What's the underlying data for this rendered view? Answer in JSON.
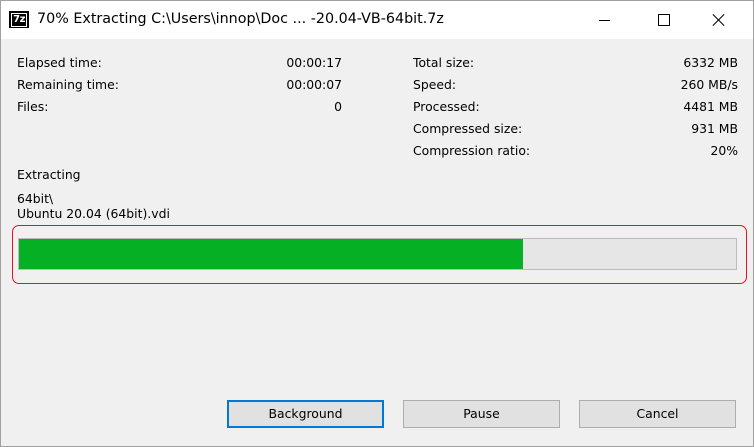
{
  "window": {
    "title": "70% Extracting C:\\Users\\innop\\Doc ... -20.04-VB-64bit.7z",
    "app_icon_text": "7z"
  },
  "stats_left": [
    {
      "label": "Elapsed time:",
      "value": "00:00:17"
    },
    {
      "label": "Remaining time:",
      "value": "00:00:07"
    },
    {
      "label": "Files:",
      "value": "0"
    }
  ],
  "stats_right": [
    {
      "label": "Total size:",
      "value": "6332 MB"
    },
    {
      "label": "Speed:",
      "value": "260 MB/s"
    },
    {
      "label": "Processed:",
      "value": "4481 MB"
    },
    {
      "label": "Compressed size:",
      "value": "931 MB"
    },
    {
      "label": "Compression ratio:",
      "value": "20%"
    }
  ],
  "operation": {
    "status": "Extracting",
    "folder": "64bit\\",
    "file": "Ubuntu 20.04 (64bit).vdi"
  },
  "progress": {
    "fraction": 0.703,
    "fill_color": "#06b025",
    "highlight_color": "#e81123"
  },
  "buttons": {
    "background": "Background",
    "pause": "Pause",
    "cancel": "Cancel"
  }
}
